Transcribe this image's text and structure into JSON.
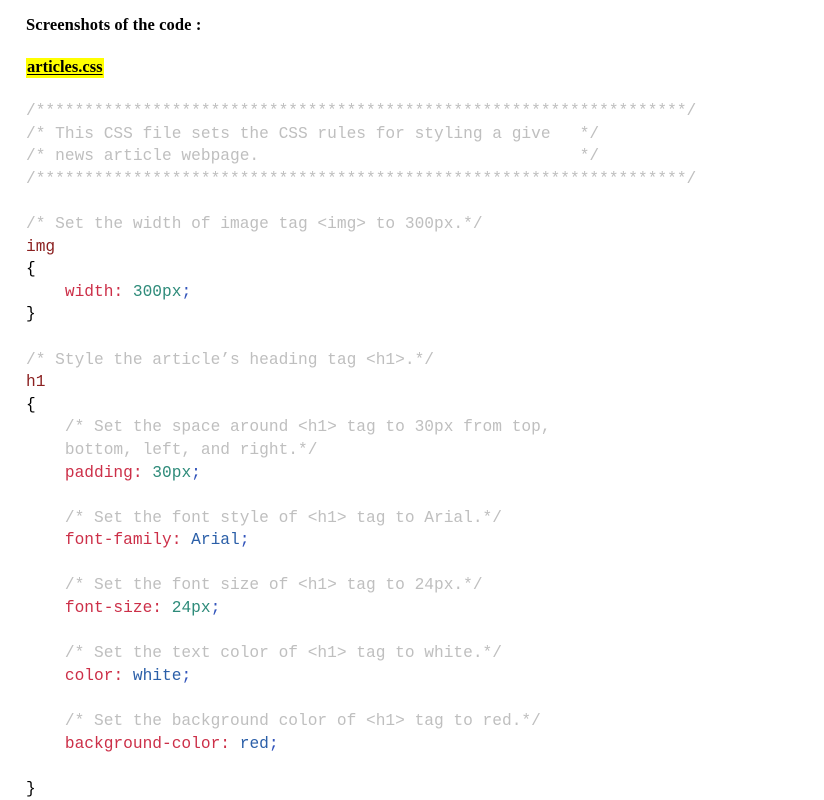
{
  "document": {
    "title": "Screenshots of the code :",
    "file_name": "articles.css",
    "highlight_color": "#ffff00"
  },
  "theme": {
    "background": "#ffffff",
    "comment": "#bfbfbf",
    "selector": "#8b2020",
    "property": "#cc2f48",
    "number": "#2e8b7a",
    "keyword": "#2b5fa8",
    "semicolon": "#3355bb",
    "brace": "#000000"
  },
  "code": {
    "language": "css",
    "lines": [
      {
        "type": "comment",
        "text": "/*******************************************************************/"
      },
      {
        "type": "comment",
        "text": "/* This CSS file sets the CSS rules for styling a give   */"
      },
      {
        "type": "comment",
        "text": "/* news article webpage.                                 */"
      },
      {
        "type": "comment",
        "text": "/*******************************************************************/"
      },
      {
        "type": "blank",
        "text": ""
      },
      {
        "type": "comment",
        "text": "/* Set the width of image tag <img> to 300px.*/"
      },
      {
        "type": "selector",
        "text": "img"
      },
      {
        "type": "brace",
        "text": "{"
      },
      {
        "type": "declaration",
        "indent": 4,
        "property": "width",
        "colon": ": ",
        "value": "300px",
        "value_kind": "number",
        "semicolon": ";"
      },
      {
        "type": "brace",
        "text": "}"
      },
      {
        "type": "blank",
        "text": ""
      },
      {
        "type": "comment",
        "text": "/* Style the article’s heading tag <h1>.*/"
      },
      {
        "type": "selector",
        "text": "h1"
      },
      {
        "type": "brace",
        "text": "{"
      },
      {
        "type": "comment",
        "indent": 4,
        "text": "/* Set the space around <h1> tag to 30px from top,"
      },
      {
        "type": "comment",
        "indent": 4,
        "text": "bottom, left, and right.*/"
      },
      {
        "type": "declaration",
        "indent": 4,
        "property": "padding",
        "colon": ": ",
        "value": "30px",
        "value_kind": "number",
        "semicolon": ";"
      },
      {
        "type": "blank",
        "text": ""
      },
      {
        "type": "comment",
        "indent": 4,
        "text": "/* Set the font style of <h1> tag to Arial.*/"
      },
      {
        "type": "declaration",
        "indent": 4,
        "property": "font-family",
        "colon": ": ",
        "value": "Arial",
        "value_kind": "keyword",
        "semicolon": ";"
      },
      {
        "type": "blank",
        "text": ""
      },
      {
        "type": "comment",
        "indent": 4,
        "text": "/* Set the font size of <h1> tag to 24px.*/"
      },
      {
        "type": "declaration",
        "indent": 4,
        "property": "font-size",
        "colon": ": ",
        "value": "24px",
        "value_kind": "number",
        "semicolon": ";"
      },
      {
        "type": "blank",
        "text": ""
      },
      {
        "type": "comment",
        "indent": 4,
        "text": "/* Set the text color of <h1> tag to white.*/"
      },
      {
        "type": "declaration",
        "indent": 4,
        "property": "color",
        "colon": ": ",
        "value": "white",
        "value_kind": "keyword",
        "semicolon": ";"
      },
      {
        "type": "blank",
        "text": ""
      },
      {
        "type": "comment",
        "indent": 4,
        "text": "/* Set the background color of <h1> tag to red.*/"
      },
      {
        "type": "declaration",
        "indent": 4,
        "property": "background-color",
        "colon": ": ",
        "value": "red",
        "value_kind": "keyword",
        "semicolon": ";"
      },
      {
        "type": "blank",
        "text": ""
      },
      {
        "type": "brace",
        "text": "}"
      }
    ]
  }
}
